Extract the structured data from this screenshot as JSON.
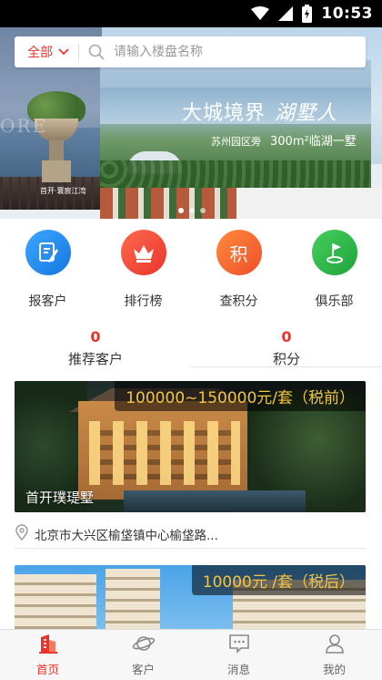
{
  "status_bar": {
    "time": "10:53"
  },
  "banner": {
    "left_caption": "首开·寰宸江湾",
    "ghost_text": "ORE",
    "headline_main": "大城境界",
    "headline_script": "湖墅人",
    "subline_text": "苏州园区旁",
    "subline_area": "300m²临湖一墅"
  },
  "search": {
    "scope_label": "全部",
    "placeholder": "请输入楼盘名称"
  },
  "shortcuts": [
    {
      "label": "报客户",
      "icon": "document-edit-icon",
      "color": "#1e90f0"
    },
    {
      "label": "排行榜",
      "icon": "crown-icon",
      "color": "#f0473a"
    },
    {
      "label": "查积分",
      "icon": "points-icon",
      "glyph": "积",
      "color": "#f2632f"
    },
    {
      "label": "俱乐部",
      "icon": "golf-flag-icon",
      "color": "#2bb34a"
    }
  ],
  "stats": [
    {
      "value": "0",
      "caption": "推荐客户"
    },
    {
      "value": "0",
      "caption": "积分"
    }
  ],
  "listings": [
    {
      "price": "100000~150000元/套（税前）",
      "name": "首开璞瑅墅",
      "address": "北京市大兴区榆垡镇中心榆垡路..."
    },
    {
      "price": "10000元 /套（税后）"
    }
  ],
  "tabbar": [
    {
      "label": "首页",
      "icon": "home-building-icon",
      "active": true
    },
    {
      "label": "客户",
      "icon": "planet-icon",
      "active": false
    },
    {
      "label": "消息",
      "icon": "message-icon",
      "active": false
    },
    {
      "label": "我的",
      "icon": "user-icon",
      "active": false
    }
  ],
  "colors": {
    "accent": "#e8342d",
    "price": "#f4c542"
  }
}
